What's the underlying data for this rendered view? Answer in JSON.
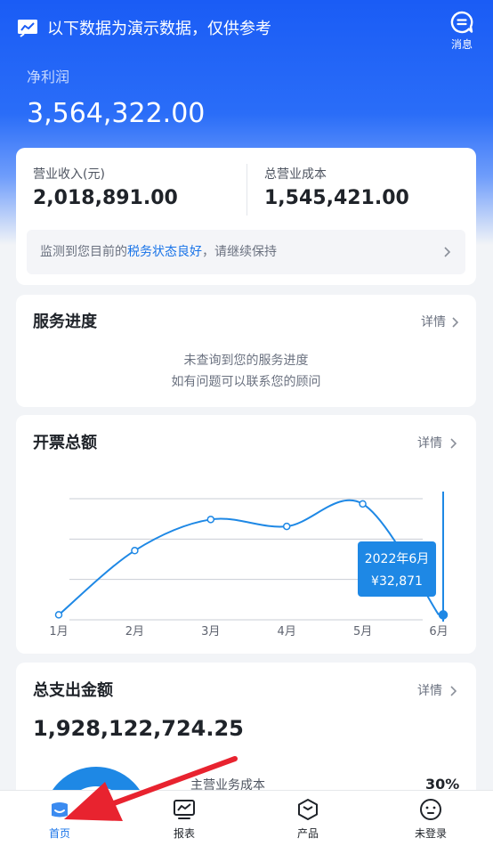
{
  "header": {
    "demo_notice": "以下数据为演示数据，仅供参考",
    "message_label": "消息"
  },
  "net_profit": {
    "label": "净利润",
    "value": "3,564,322.00"
  },
  "summary": {
    "revenue_label": "营业收入(元)",
    "revenue_value": "2,018,891.00",
    "cost_label": "总营业成本",
    "cost_value": "1,545,421.00",
    "tax_prefix": "监测到您目前的",
    "tax_highlight": "税务状态良好",
    "tax_suffix": "，请继续保持"
  },
  "service": {
    "title": "服务进度",
    "detail": "详情",
    "empty_line1": "未查询到您的服务进度",
    "empty_line2": "如有问题可以联系您的顾问"
  },
  "invoice": {
    "title": "开票总额",
    "detail": "详情"
  },
  "chart_data": {
    "type": "line",
    "categories": [
      "1月",
      "2月",
      "3月",
      "4月",
      "5月",
      "6月"
    ],
    "values": [
      32871,
      70000,
      88000,
      84000,
      97000,
      32871
    ],
    "ylim": [
      30000,
      100000
    ],
    "grid": true,
    "tooltip": {
      "index": 5,
      "title": "2022年6月",
      "value": "¥32,871"
    },
    "colors": {
      "line": "#1e88e5",
      "tooltip_bg": "#1e88e5",
      "grid": "#c9cdd4"
    }
  },
  "expense": {
    "title": "总支出金额",
    "detail": "详情",
    "value": "1,928,122,724.25",
    "item_label": "主营业务成本",
    "item_pct": "30%"
  },
  "tabs": [
    {
      "label": "首页",
      "icon": "home-icon",
      "active": true
    },
    {
      "label": "报表",
      "icon": "report-icon",
      "active": false
    },
    {
      "label": "产品",
      "icon": "product-icon",
      "active": false
    },
    {
      "label": "未登录",
      "icon": "user-icon",
      "active": false
    }
  ],
  "colors": {
    "brand_blue": "#1a5cf5",
    "accent": "#1a74e8",
    "annotation_arrow": "#e8232f"
  }
}
